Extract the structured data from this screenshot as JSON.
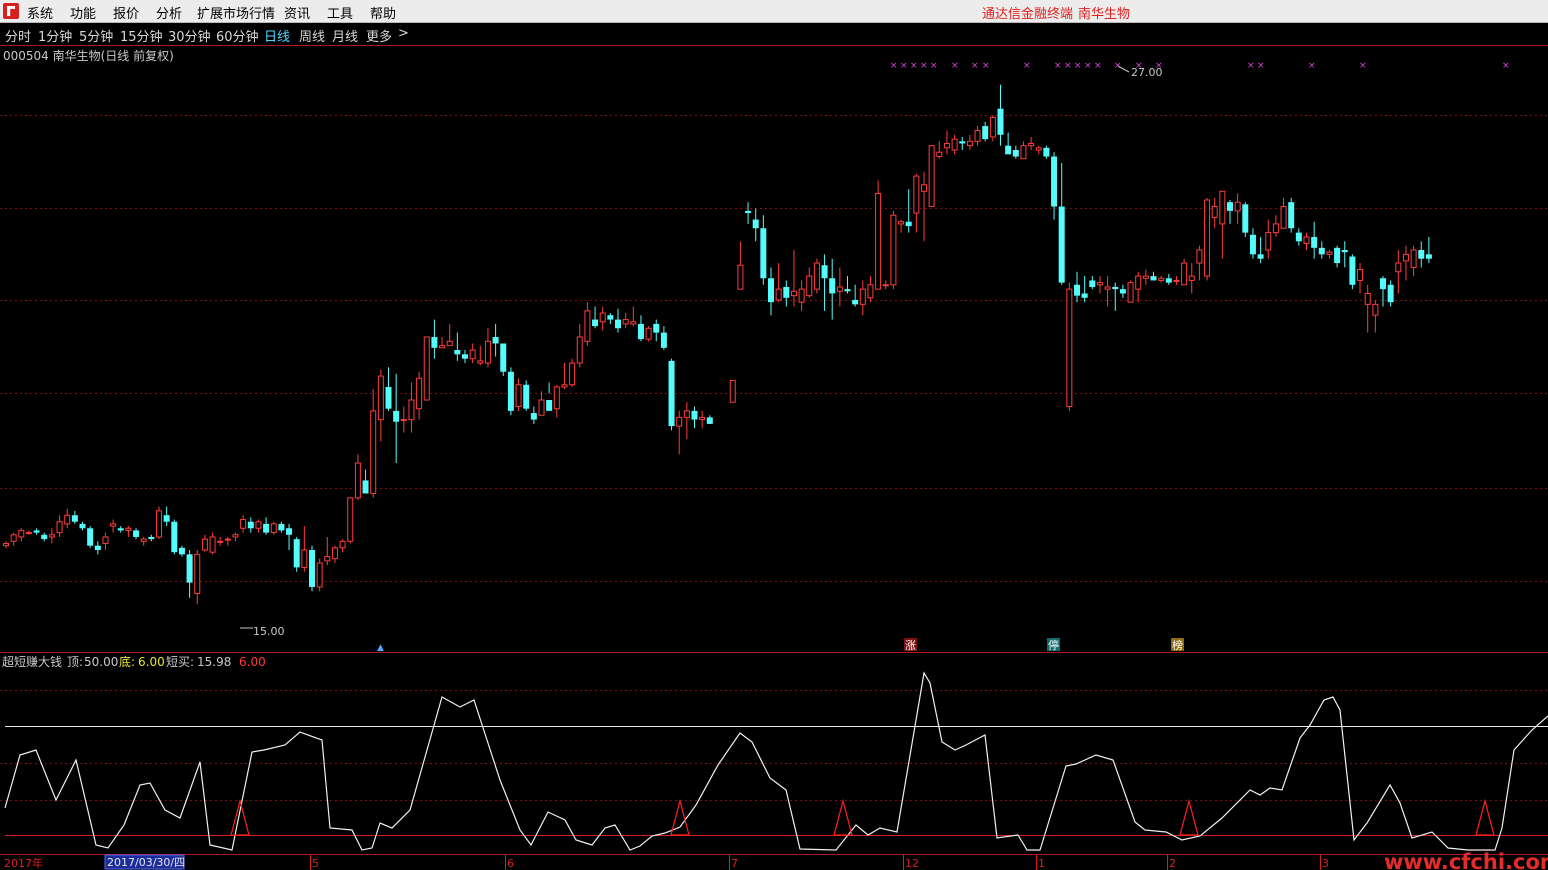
{
  "menu": {
    "items": [
      "系统",
      "功能",
      "报价",
      "分析",
      "扩展市场行情",
      "资讯",
      "工具",
      "帮助"
    ],
    "title_left": "通达信金融终端",
    "title_right": "南华生物"
  },
  "period_bar": {
    "items": [
      "分时",
      "1分钟",
      "5分钟",
      "15分钟",
      "30分钟",
      "60分钟",
      "日线",
      "周线",
      "月线",
      "更多"
    ],
    "active": "日线",
    "more_arrow": ">"
  },
  "main_chart": {
    "header": "000504 南华生物(日线 前复权)",
    "high_label": "27.00",
    "low_label": "15.00",
    "ylim": [
      14.0,
      27.8
    ]
  },
  "markers": {
    "up_arrow": "▲",
    "zhang": "涨",
    "ting": "停",
    "bang": "榜"
  },
  "indicator": {
    "name": "超短赚大钱",
    "top_label": "顶:",
    "top_value": "50.00",
    "bottom_label": "底:",
    "bottom_value": "6.00",
    "buy_label": "短买:",
    "buy_value": "15.98",
    "extra_value": "6.00",
    "ylim": [
      -5,
      55
    ],
    "top_line": 40,
    "bottom_line": 4
  },
  "x_axis": {
    "labels": [
      "2017年",
      "2017/03/30/四",
      "5",
      "6",
      "7",
      "12",
      "1",
      "2",
      "3"
    ]
  },
  "watermark": "www.cfchi.com",
  "colors": {
    "up": "#ff3c3c",
    "down": "#54fcfc",
    "grid": "#801010",
    "border": "#b01818",
    "cross": "#e040e0"
  },
  "chart_data": {
    "type": "candlestick",
    "candles": [
      [
        16.4,
        16.5,
        16.35,
        16.45
      ],
      [
        16.5,
        16.7,
        16.4,
        16.65
      ],
      [
        16.6,
        16.8,
        16.5,
        16.75
      ],
      [
        16.7,
        16.75,
        16.65,
        16.7
      ],
      [
        16.75,
        16.8,
        16.65,
        16.7
      ],
      [
        16.65,
        16.7,
        16.5,
        16.55
      ],
      [
        16.6,
        16.8,
        16.45,
        16.65
      ],
      [
        16.7,
        17.1,
        16.6,
        16.95
      ],
      [
        16.9,
        17.25,
        16.8,
        17.1
      ],
      [
        17.1,
        17.2,
        16.9,
        16.95
      ],
      [
        16.9,
        16.95,
        16.75,
        16.8
      ],
      [
        16.8,
        16.85,
        16.35,
        16.4
      ],
      [
        16.4,
        16.5,
        16.2,
        16.3
      ],
      [
        16.45,
        16.7,
        16.3,
        16.6
      ],
      [
        16.85,
        17.0,
        16.7,
        16.9
      ],
      [
        16.8,
        16.85,
        16.7,
        16.75
      ],
      [
        16.75,
        16.85,
        16.6,
        16.8
      ],
      [
        16.75,
        16.8,
        16.55,
        16.6
      ],
      [
        16.5,
        16.6,
        16.4,
        16.55
      ],
      [
        16.6,
        16.65,
        16.5,
        16.55
      ],
      [
        16.6,
        17.3,
        16.55,
        17.2
      ],
      [
        17.1,
        17.3,
        16.85,
        16.95
      ],
      [
        16.95,
        17.0,
        16.2,
        16.25
      ],
      [
        16.35,
        16.4,
        16.15,
        16.2
      ],
      [
        16.2,
        16.3,
        15.2,
        15.55
      ],
      [
        15.3,
        16.3,
        15.05,
        16.2
      ],
      [
        16.3,
        16.65,
        16.25,
        16.55
      ],
      [
        16.25,
        16.7,
        16.2,
        16.6
      ],
      [
        16.5,
        16.6,
        16.4,
        16.5
      ],
      [
        16.55,
        16.6,
        16.4,
        16.55
      ],
      [
        16.6,
        16.7,
        16.5,
        16.65
      ],
      [
        16.8,
        17.1,
        16.7,
        17.0
      ],
      [
        16.95,
        17.05,
        16.7,
        16.8
      ],
      [
        16.8,
        17.0,
        16.7,
        16.95
      ],
      [
        16.9,
        17.05,
        16.65,
        16.7
      ],
      [
        16.7,
        16.95,
        16.65,
        16.9
      ],
      [
        16.9,
        16.95,
        16.7,
        16.75
      ],
      [
        16.8,
        16.9,
        16.3,
        16.65
      ],
      [
        16.55,
        16.6,
        15.8,
        15.9
      ],
      [
        15.9,
        16.85,
        15.8,
        16.3
      ],
      [
        16.3,
        16.4,
        15.35,
        15.45
      ],
      [
        15.45,
        16.1,
        15.35,
        16.0
      ],
      [
        16.05,
        16.6,
        15.95,
        16.15
      ],
      [
        16.1,
        16.4,
        16.0,
        16.35
      ],
      [
        16.35,
        16.55,
        16.25,
        16.5
      ],
      [
        16.5,
        17.5,
        16.45,
        17.5
      ],
      [
        17.5,
        18.5,
        17.45,
        18.3
      ],
      [
        17.9,
        18.15,
        17.6,
        17.6
      ],
      [
        17.6,
        20.0,
        17.5,
        19.5
      ],
      [
        19.3,
        20.45,
        18.8,
        20.3
      ],
      [
        20.05,
        20.5,
        19.5,
        19.55
      ],
      [
        19.5,
        20.35,
        18.3,
        19.25
      ],
      [
        19.3,
        19.6,
        19.0,
        19.3
      ],
      [
        19.3,
        20.15,
        19.0,
        19.75
      ],
      [
        19.55,
        20.4,
        19.3,
        20.25
      ],
      [
        19.75,
        21.2,
        19.75,
        21.2
      ],
      [
        21.2,
        21.6,
        20.7,
        20.95
      ],
      [
        20.95,
        21.2,
        20.95,
        21.0
      ],
      [
        21.0,
        21.5,
        21.0,
        21.1
      ],
      [
        20.9,
        21.3,
        20.65,
        20.8
      ],
      [
        20.8,
        20.9,
        20.6,
        20.7
      ],
      [
        20.7,
        21.05,
        20.6,
        20.9
      ],
      [
        20.6,
        21.0,
        20.55,
        20.65
      ],
      [
        20.6,
        21.4,
        20.5,
        21.1
      ],
      [
        21.2,
        21.5,
        20.75,
        21.05
      ],
      [
        21.05,
        21.05,
        20.3,
        20.4
      ],
      [
        20.4,
        20.5,
        19.4,
        19.5
      ],
      [
        19.6,
        20.25,
        19.5,
        20.1
      ],
      [
        20.1,
        20.2,
        19.5,
        19.55
      ],
      [
        19.45,
        19.6,
        19.2,
        19.3
      ],
      [
        19.4,
        19.95,
        19.4,
        19.75
      ],
      [
        19.75,
        20.15,
        19.9,
        19.5
      ],
      [
        19.55,
        20.1,
        19.35,
        20.05
      ],
      [
        20.05,
        20.6,
        20.0,
        20.1
      ],
      [
        20.1,
        20.7,
        20.05,
        20.6
      ],
      [
        20.6,
        21.5,
        20.5,
        21.2
      ],
      [
        21.1,
        22.0,
        21.0,
        21.8
      ],
      [
        21.6,
        21.9,
        21.4,
        21.45
      ],
      [
        21.55,
        21.9,
        21.35,
        21.75
      ],
      [
        21.7,
        21.75,
        21.5,
        21.6
      ],
      [
        21.6,
        21.85,
        21.3,
        21.4
      ],
      [
        21.5,
        21.75,
        21.4,
        21.6
      ],
      [
        21.5,
        21.9,
        21.45,
        21.55
      ],
      [
        21.5,
        21.7,
        21.1,
        21.15
      ],
      [
        21.15,
        21.45,
        21.1,
        21.4
      ],
      [
        21.5,
        21.6,
        21.1,
        21.3
      ],
      [
        21.3,
        21.45,
        20.9,
        20.95
      ],
      [
        20.65,
        20.7,
        19.05,
        19.15
      ],
      [
        19.15,
        19.5,
        18.5,
        19.35
      ],
      [
        19.35,
        19.7,
        18.85,
        19.5
      ],
      [
        19.5,
        19.6,
        19.1,
        19.3
      ],
      [
        19.3,
        19.5,
        19.1,
        19.35
      ],
      [
        19.35,
        19.4,
        19.2,
        19.2
      ],
      [
        null,
        null,
        null,
        null
      ],
      [
        null,
        null,
        null,
        null
      ],
      [
        19.7,
        20.2,
        19.7,
        20.2
      ],
      [
        22.3,
        23.4,
        22.3,
        22.85
      ],
      [
        24.1,
        24.3,
        23.8,
        24.05
      ],
      [
        23.9,
        24.15,
        23.4,
        23.7
      ],
      [
        23.7,
        24.0,
        22.4,
        22.55
      ],
      [
        22.55,
        22.8,
        21.7,
        22.0
      ],
      [
        22.05,
        22.9,
        22.0,
        22.3
      ],
      [
        22.35,
        22.5,
        21.9,
        22.1
      ],
      [
        22.15,
        23.2,
        21.9,
        22.25
      ],
      [
        22.0,
        22.5,
        21.8,
        22.3
      ],
      [
        22.15,
        22.8,
        22.1,
        22.6
      ],
      [
        22.3,
        23.0,
        22.2,
        22.9
      ],
      [
        22.85,
        23.1,
        21.8,
        22.55
      ],
      [
        22.55,
        23.0,
        21.6,
        22.2
      ],
      [
        22.25,
        22.8,
        21.9,
        22.35
      ],
      [
        22.3,
        22.6,
        22.2,
        22.25
      ],
      [
        22.05,
        22.4,
        21.9,
        21.95
      ],
      [
        21.95,
        22.5,
        21.7,
        22.3
      ],
      [
        22.1,
        22.6,
        22.0,
        22.4
      ],
      [
        22.3,
        24.8,
        22.3,
        24.5
      ],
      [
        22.4,
        22.5,
        22.3,
        22.4
      ],
      [
        22.4,
        24.1,
        22.3,
        24.0
      ],
      [
        23.8,
        23.9,
        23.6,
        23.85
      ],
      [
        23.85,
        24.6,
        23.6,
        23.75
      ],
      [
        24.05,
        24.95,
        23.6,
        24.9
      ],
      [
        24.55,
        25.0,
        23.4,
        24.7
      ],
      [
        24.2,
        25.3,
        24.2,
        25.6
      ],
      [
        25.35,
        25.7,
        25.3,
        25.45
      ],
      [
        25.55,
        25.95,
        25.4,
        25.65
      ],
      [
        25.5,
        25.85,
        25.4,
        25.75
      ],
      [
        25.7,
        25.8,
        25.5,
        25.65
      ],
      [
        25.6,
        25.85,
        25.5,
        25.7
      ],
      [
        25.7,
        26.05,
        25.6,
        25.95
      ],
      [
        26.05,
        26.15,
        25.7,
        25.75
      ],
      [
        25.8,
        26.3,
        25.7,
        26.25
      ],
      [
        26.45,
        27.0,
        25.6,
        25.85
      ],
      [
        25.6,
        25.9,
        25.45,
        25.4
      ],
      [
        25.5,
        25.6,
        25.3,
        25.35
      ],
      [
        25.3,
        25.7,
        25.3,
        25.6
      ],
      [
        25.6,
        25.8,
        25.5,
        25.65
      ],
      [
        25.5,
        25.6,
        25.4,
        25.55
      ],
      [
        25.55,
        25.6,
        25.3,
        25.35
      ],
      [
        25.35,
        25.45,
        23.9,
        24.2
      ],
      [
        24.2,
        25.2,
        22.4,
        22.45
      ],
      [
        19.6,
        22.45,
        19.5,
        22.3
      ],
      [
        22.4,
        22.7,
        22.0,
        22.15
      ],
      [
        22.2,
        22.6,
        22.0,
        22.1
      ],
      [
        22.5,
        22.6,
        22.3,
        22.35
      ],
      [
        22.4,
        22.6,
        22.2,
        22.45
      ],
      [
        22.3,
        22.6,
        21.9,
        22.35
      ],
      [
        22.35,
        22.45,
        21.8,
        22.3
      ],
      [
        22.3,
        22.4,
        22.1,
        22.2
      ],
      [
        22.0,
        22.5,
        22.0,
        22.45
      ],
      [
        22.3,
        22.7,
        22.0,
        22.6
      ],
      [
        22.55,
        22.75,
        22.4,
        22.6
      ],
      [
        22.6,
        22.7,
        22.5,
        22.5
      ],
      [
        22.5,
        22.6,
        22.45,
        22.55
      ],
      [
        22.55,
        22.65,
        22.4,
        22.45
      ],
      [
        22.5,
        22.6,
        22.4,
        22.5
      ],
      [
        22.4,
        23.0,
        22.4,
        22.9
      ],
      [
        22.5,
        22.9,
        22.2,
        22.6
      ],
      [
        22.9,
        23.3,
        22.5,
        23.2
      ],
      [
        22.6,
        24.4,
        22.5,
        24.35
      ],
      [
        23.95,
        24.4,
        23.7,
        24.2
      ],
      [
        23.8,
        24.5,
        23.0,
        24.55
      ],
      [
        24.3,
        24.35,
        23.8,
        24.1
      ],
      [
        24.1,
        24.5,
        23.8,
        24.3
      ],
      [
        24.25,
        24.3,
        23.5,
        23.6
      ],
      [
        23.55,
        23.7,
        23.0,
        23.1
      ],
      [
        23.1,
        23.5,
        22.9,
        23.0
      ],
      [
        23.2,
        23.9,
        23.0,
        23.6
      ],
      [
        23.6,
        24.0,
        23.5,
        23.8
      ],
      [
        23.7,
        24.4,
        23.7,
        24.2
      ],
      [
        24.3,
        24.4,
        23.6,
        23.7
      ],
      [
        23.6,
        23.7,
        23.3,
        23.4
      ],
      [
        23.35,
        23.6,
        23.2,
        23.5
      ],
      [
        23.5,
        23.85,
        23.0,
        23.25
      ],
      [
        23.25,
        23.4,
        23.0,
        23.1
      ],
      [
        23.1,
        23.2,
        23.0,
        23.15
      ],
      [
        23.25,
        23.3,
        22.8,
        22.9
      ],
      [
        23.2,
        23.4,
        22.8,
        23.15
      ],
      [
        23.05,
        23.1,
        22.3,
        22.4
      ],
      [
        22.5,
        22.9,
        22.2,
        22.75
      ],
      [
        21.95,
        22.4,
        21.3,
        22.2
      ],
      [
        21.7,
        22.05,
        21.3,
        21.95
      ],
      [
        22.55,
        22.6,
        21.9,
        22.3
      ],
      [
        22.4,
        22.5,
        21.9,
        22.0
      ],
      [
        22.7,
        23.2,
        22.2,
        22.9
      ],
      [
        22.95,
        23.3,
        22.5,
        23.1
      ],
      [
        22.8,
        23.3,
        22.6,
        23.2
      ],
      [
        23.2,
        23.4,
        22.8,
        23.0
      ],
      [
        23.1,
        23.5,
        22.9,
        23.0
      ]
    ],
    "x_labels": [
      "2017年",
      "5",
      "6",
      "7",
      "12",
      "1",
      "2",
      "3"
    ]
  }
}
